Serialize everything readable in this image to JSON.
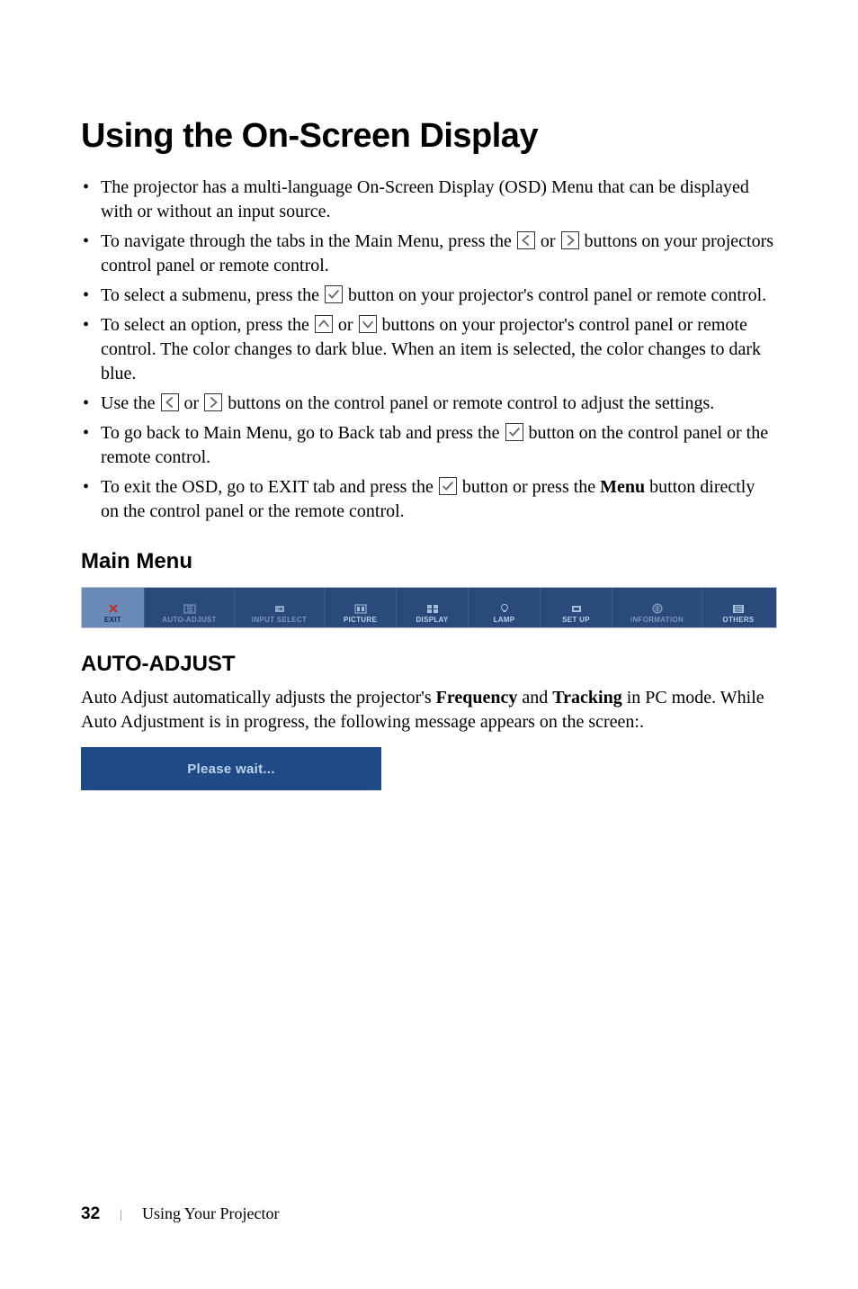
{
  "heading": "Using the On-Screen Display",
  "bullets": {
    "b1": "The projector has a multi-language On-Screen Display (OSD) Menu that can be displayed with or without an input source.",
    "b2a": "To navigate through the tabs in the Main Menu, press the ",
    "b2mid": " or ",
    "b2b": " buttons on your projectors control panel or remote control.",
    "b3a": "To select a submenu, press the ",
    "b3b": " button on your projector's control panel or remote control.",
    "b4a": "To select an option, press the ",
    "b4mid": " or ",
    "b4b": " buttons on your projector's control panel or remote control. The color changes to dark blue. When an item is selected, the color changes to dark blue.",
    "b5a": "Use the ",
    "b5mid": " or ",
    "b5b": " buttons on the control panel or remote control to adjust the settings.",
    "b6a": "To go back to Main Menu, go to Back tab and press the ",
    "b6b": " button on the control panel or the remote control.",
    "b7a": "To exit the OSD, go to EXIT tab and press the ",
    "b7b": " button or press the ",
    "b7menu": "Menu",
    "b7c": " button directly on the control panel or the remote control."
  },
  "main_menu_heading": "Main Menu",
  "menu": {
    "items": [
      {
        "label": "EXIT"
      },
      {
        "label": "AUTO-ADJUST"
      },
      {
        "label": "INPUT SELECT"
      },
      {
        "label": "PICTURE"
      },
      {
        "label": "DISPLAY"
      },
      {
        "label": "LAMP"
      },
      {
        "label": "SET UP"
      },
      {
        "label": "INFORMATION"
      },
      {
        "label": "OTHERS"
      }
    ]
  },
  "auto_adjust": {
    "heading": "AUTO-ADJUST",
    "text_a": "Auto Adjust automatically adjusts the projector's ",
    "freq": "Frequency",
    "text_b": " and ",
    "track": "Tracking",
    "text_c": " in PC mode. While Auto Adjustment is in progress, the following message appears on the screen:.",
    "please_wait": "Please wait..."
  },
  "footer": {
    "pagenum": "32",
    "chapter": "Using Your Projector"
  }
}
